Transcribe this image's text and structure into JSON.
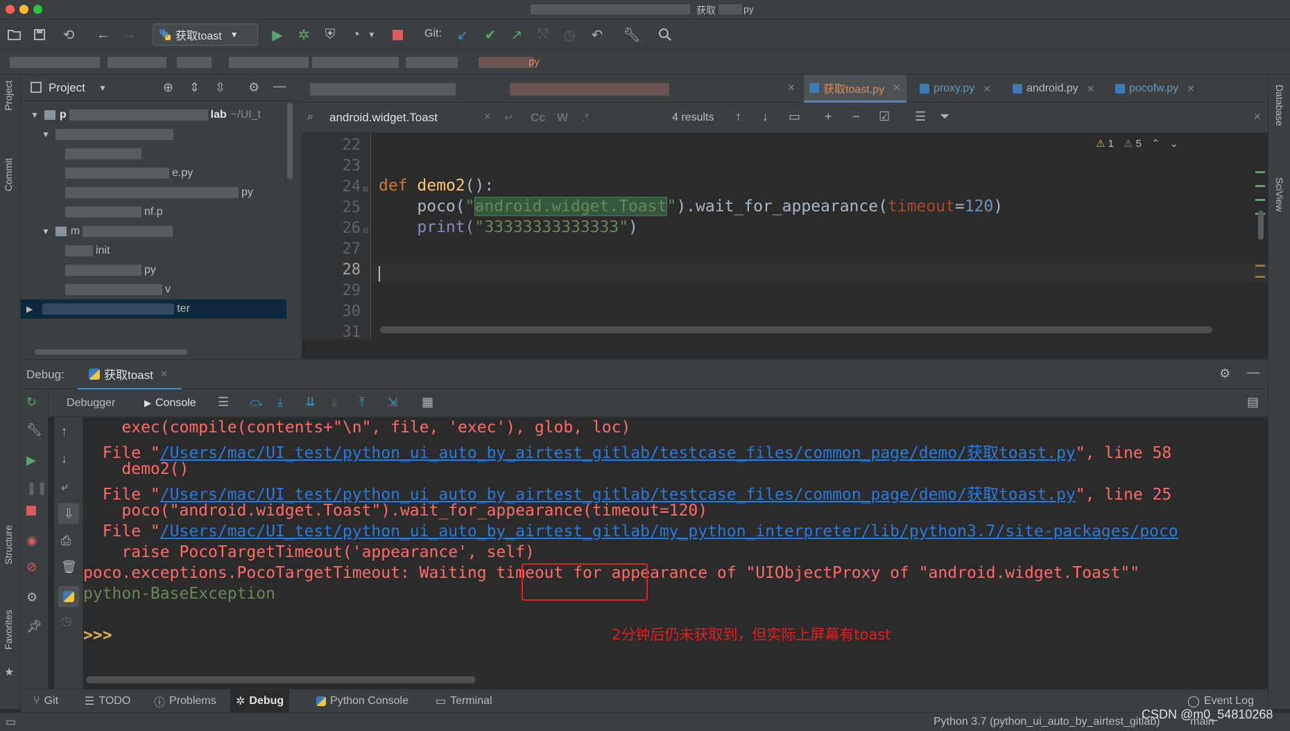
{
  "window": {
    "title_prefix": "获取",
    "title_suffix": "py"
  },
  "toolbar": {
    "run_config": "获取toast",
    "git_label": "Git:"
  },
  "navbar": {
    "visible_fragment": "py"
  },
  "left_strip": {
    "project_label": "Project",
    "commit_label": "Commit",
    "structure_label": "Structure",
    "favorites_label": "Favorites"
  },
  "right_strip": {
    "database_label": "Database",
    "sciview_label": "SciView"
  },
  "project_panel": {
    "title": "Project",
    "root_name": "p",
    "root_suffix": "lab",
    "root_path": "~/UI_t",
    "rows": [
      {
        "label": "e.py"
      },
      {
        "label": "py"
      },
      {
        "label": "nf.p"
      },
      {
        "label": "m"
      },
      {
        "label": "init"
      },
      {
        "label": "py"
      },
      {
        "label": "v"
      },
      {
        "label": "ter"
      }
    ]
  },
  "editor": {
    "tabs": [
      {
        "label": "获取toast.py",
        "active": true
      },
      {
        "label": "proxy.py",
        "active": false
      },
      {
        "label": "android.py",
        "active": false
      },
      {
        "label": "pocofw.py",
        "active": false
      }
    ],
    "find": {
      "query": "android.widget.Toast",
      "results": "4 results",
      "case_label": "Cc",
      "word_label": "W",
      "regex_label": ".*"
    },
    "inspections": {
      "warnings": "1",
      "weak_warnings": "5"
    },
    "line_numbers": [
      "22",
      "23",
      "24",
      "25",
      "26",
      "27",
      "28",
      "29",
      "30",
      "31"
    ],
    "code": {
      "line24_kw": "def",
      "line24_fn": "demo2",
      "line24_rest": "():",
      "line25_a": "poco(",
      "line25_str_open": "\"",
      "line25_str_hl": "android.widget.Toast",
      "line25_str_close": "\"",
      "line25_b": ").wait_for_appearance(",
      "line25_param": "timeout",
      "line25_eq": "=",
      "line25_num": "120",
      "line25_c": ")",
      "line26_a": "print(",
      "line26_str": "\"33333333333333\"",
      "line26_b": ")"
    }
  },
  "debug": {
    "label": "Debug:",
    "session_tab": "获取toast",
    "debugger_tab": "Debugger",
    "console_tab": "Console",
    "console_lines": {
      "l1": "    exec(compile(contents+\"\\n\", file, 'exec'), glob, loc)",
      "l2_a": "  File \"",
      "l2_link": "/Users/mac/UI_test/python_ui_auto_by_airtest_gitlab/testcase_files/common_page/demo/获取toast.py",
      "l2_b": "\", line 58",
      "l3": "    demo2()",
      "l4_a": "  File \"",
      "l4_link": "/Users/mac/UI_test/python_ui_auto_by_airtest_gitlab/testcase_files/common_page/demo/获取toast.py",
      "l4_b": "\", line 25",
      "l5": "    poco(\"android.widget.Toast\").wait_for_appearance(timeout=120)",
      "l6_a": "  File \"",
      "l6_link": "/Users/mac/UI_test/python_ui_auto_by_airtest_gitlab/my_python_interpreter/lib/python3.7/site-packages/poco",
      "l7": "    raise PocoTargetTimeout('appearance', self)",
      "l8": "poco.exceptions.PocoTargetTimeout: Waiting timeout for appearance of \"UIObjectProxy of \"android.widget.Toast\"\"",
      "l9": "python-BaseException",
      "prompt": ">>>"
    },
    "annotation": "2分钟后仍未获取到，但实际上屏幕有toast"
  },
  "bottom_tabs": [
    {
      "label": "Git"
    },
    {
      "label": "TODO"
    },
    {
      "label": "Problems"
    },
    {
      "label": "Debug"
    },
    {
      "label": "Python Console"
    },
    {
      "label": "Terminal"
    }
  ],
  "status": {
    "event_log": "Event Log",
    "interpreter": "Python 3.7 (python_ui_auto_by_airtest_gitlab)",
    "branch": "main",
    "watermark": "CSDN @m0_54810268"
  },
  "colors": {
    "accent": "#4a88c7",
    "error_red": "#ff6b68",
    "link_blue": "#287bde",
    "annotation_red": "#e02020"
  }
}
